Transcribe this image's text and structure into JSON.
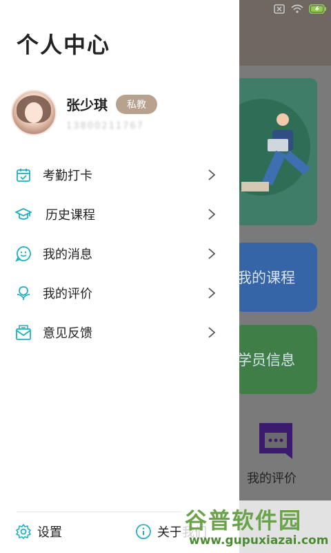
{
  "drawer": {
    "title": "个人中心",
    "profile": {
      "name": "张少琪",
      "role_badge": "私教",
      "phone": "13800211767"
    },
    "menu": [
      {
        "label": "考勤打卡",
        "icon": "calendar-check-icon"
      },
      {
        "label": "历史课程",
        "icon": "graduation-cap-icon"
      },
      {
        "label": "我的消息",
        "icon": "chat-smile-icon"
      },
      {
        "label": "我的评价",
        "icon": "review-icon"
      },
      {
        "label": "意见反馈",
        "icon": "feedback-mail-icon"
      }
    ],
    "footer": {
      "settings_label": "设置",
      "about_label": "关于我们"
    }
  },
  "background_app": {
    "card_courses": "我的课程",
    "card_students": "学员信息",
    "evaluation_label": "我的评价"
  },
  "watermark": {
    "brand": "谷普软件园",
    "url": "www.gupuxiazai.com"
  },
  "colors": {
    "accent": "#1fb0c2",
    "badge": "#b8a18e",
    "card_blue": "#3565a6",
    "card_green": "#3f7f47"
  }
}
